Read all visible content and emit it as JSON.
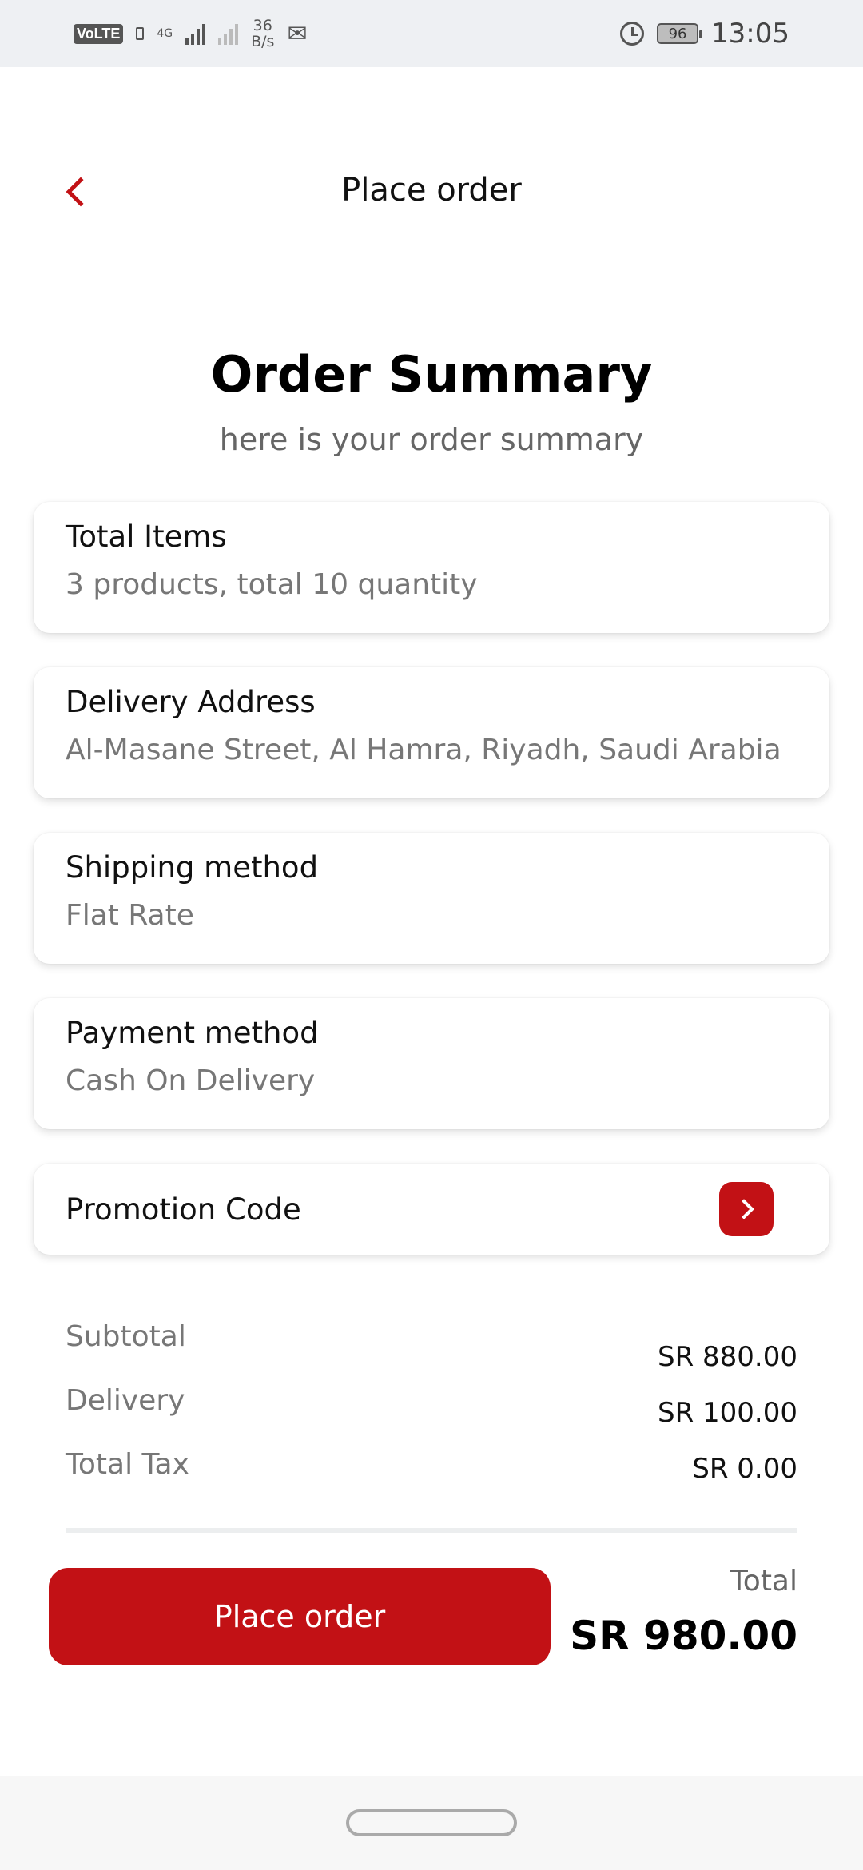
{
  "status_bar": {
    "volte": "VoLTE",
    "network": "4G",
    "speed_value": "36",
    "speed_unit": "B/s",
    "battery": "96",
    "time": "13:05"
  },
  "header": {
    "title": "Place order"
  },
  "summary": {
    "title": "Order Summary",
    "subtitle": "here is your order summary"
  },
  "cards": {
    "total_items": {
      "label": "Total Items",
      "value": "3 products, total 10 quantity"
    },
    "delivery_address": {
      "label": "Delivery Address",
      "value": "Al-Masane Street, Al Hamra, Riyadh, Saudi Arabia"
    },
    "shipping_method": {
      "label": "Shipping method",
      "value": "Flat Rate"
    },
    "payment_method": {
      "label": "Payment method",
      "value": "Cash On Delivery"
    },
    "promotion": {
      "label": "Promotion Code"
    }
  },
  "totals": {
    "subtotal_label": "Subtotal",
    "subtotal_value": "SR 880.00",
    "delivery_label": "Delivery",
    "delivery_value": "SR 100.00",
    "tax_label": "Total Tax",
    "tax_value": "SR 0.00",
    "total_label": "Total",
    "total_value": "SR 980.00"
  },
  "actions": {
    "place_order_label": "Place order"
  },
  "colors": {
    "accent": "#c21115"
  }
}
